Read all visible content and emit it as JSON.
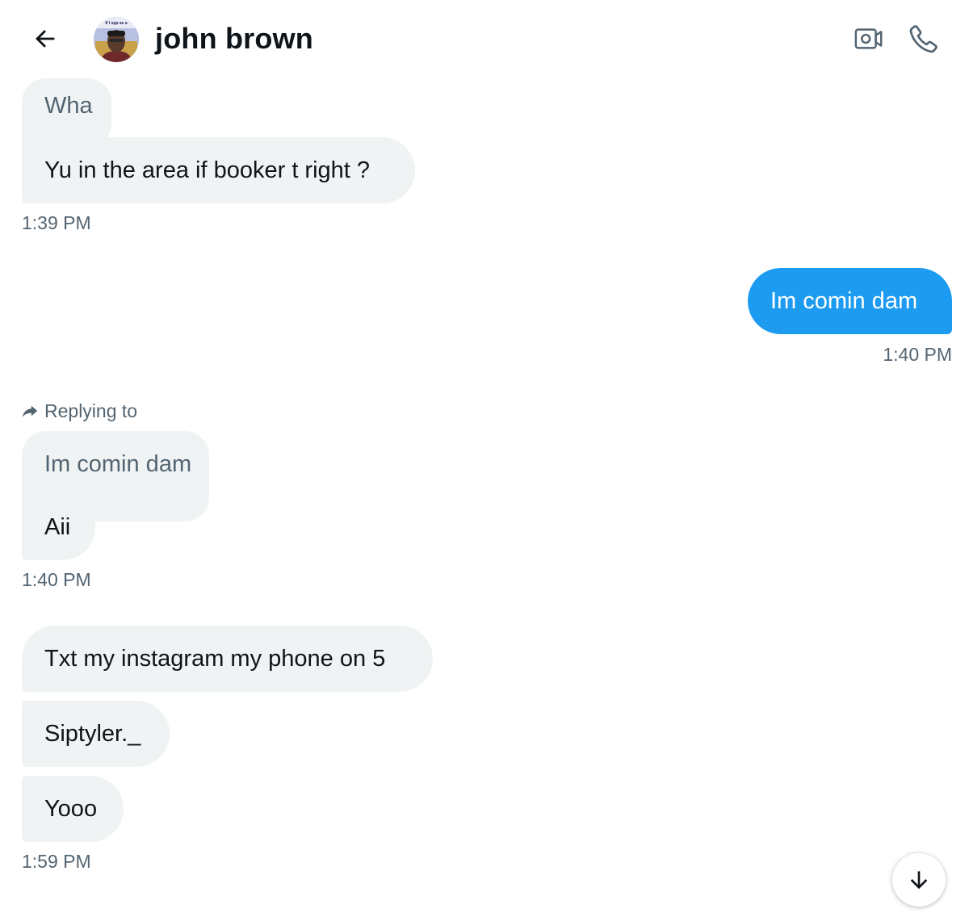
{
  "header": {
    "contact_name": "john brown",
    "back_icon": "arrow-left-icon",
    "video_icon": "video-camera-icon",
    "call_icon": "phone-icon",
    "avatar_caption": "If I spp as a"
  },
  "messages": [
    {
      "quote": "Wha",
      "text": "Yu in the area if booker t right ?",
      "time": "1:39 PM",
      "direction": "received"
    },
    {
      "text": "Im comin dam",
      "time": "1:40 PM",
      "direction": "sent"
    },
    {
      "reply_label": "Replying to",
      "quote": "Im comin dam",
      "text": "Aii",
      "time": "1:40 PM",
      "direction": "received"
    },
    {
      "texts": [
        "Txt my instagram my phone on 5",
        "Siptyler._",
        "Yooo"
      ],
      "time": "1:59 PM",
      "direction": "received"
    }
  ],
  "scroll_button": {
    "icon": "arrow-down-icon"
  },
  "colors": {
    "sent_bubble": "#1d9bf0",
    "received_bubble": "#eff3f4",
    "secondary_text": "#536471",
    "primary_text": "#0f1419"
  }
}
